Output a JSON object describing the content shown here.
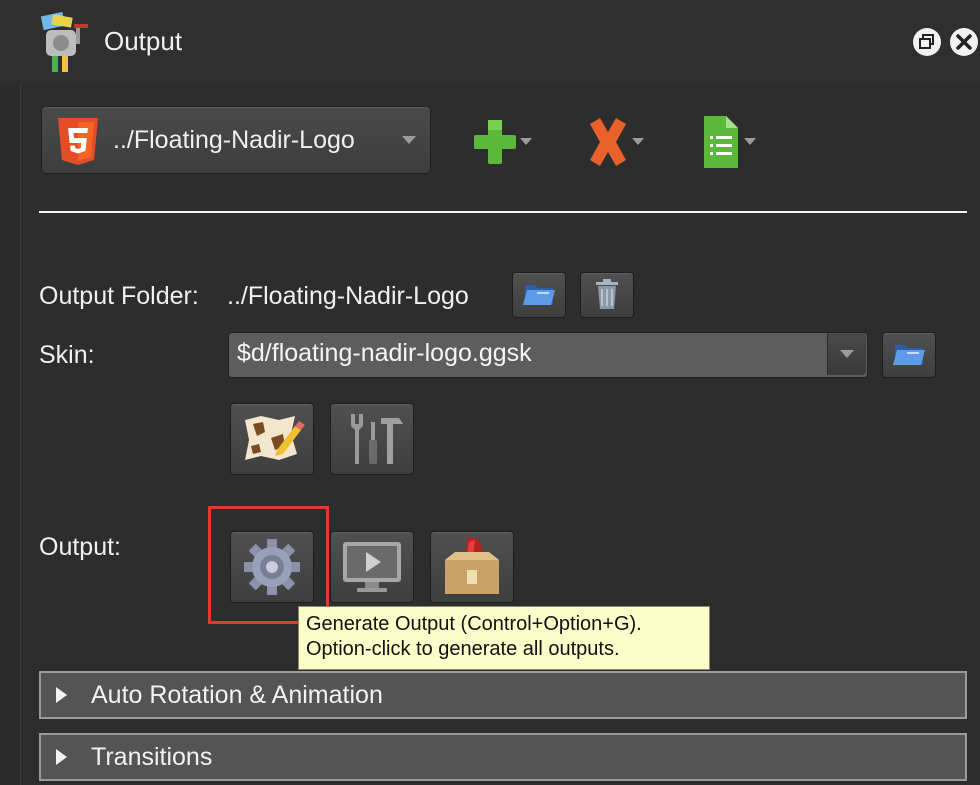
{
  "window": {
    "title": "Output",
    "restore_icon": "restore-window-icon",
    "close_icon": "close-icon"
  },
  "output_selector": {
    "icon": "html5-icon",
    "selected_value": "../Floating-Nadir-Logo"
  },
  "toolbar": {
    "add_icon": "plus-icon",
    "remove_icon": "x-icon",
    "document_icon": "document-icon"
  },
  "output_folder": {
    "label": "Output Folder:",
    "value": "../Floating-Nadir-Logo"
  },
  "skin": {
    "label": "Skin:",
    "value": "$d/floating-nadir-logo.ggsk"
  },
  "output": {
    "label": "Output:"
  },
  "tooltip": {
    "line1": "Generate Output (Control+Option+G).",
    "line2": "Option-click to generate all outputs."
  },
  "sections": [
    {
      "label": "Auto Rotation & Animation"
    },
    {
      "label": "Transitions"
    }
  ],
  "colors": {
    "accent_highlight": "#e23b2b",
    "tooltip_bg": "#fdfdc9",
    "add_green": "#5cb83a",
    "remove_orange": "#e8602a",
    "html5_orange": "#e44d26"
  }
}
